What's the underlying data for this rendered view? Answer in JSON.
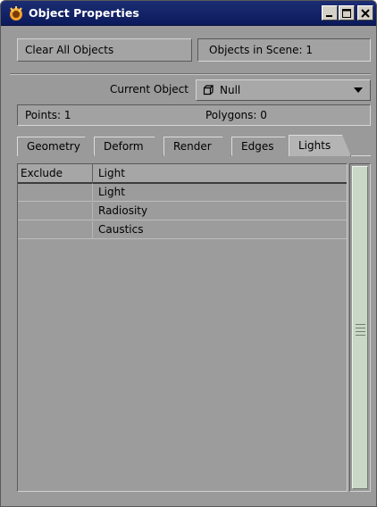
{
  "window": {
    "title": "Object Properties"
  },
  "toolbar": {
    "clear_label": "Clear All Objects",
    "objects_count": "Objects in Scene: 1"
  },
  "object_selector": {
    "label": "Current Object",
    "selected": "Null"
  },
  "counts": {
    "points": "Points: 1",
    "polygons": "Polygons: 0"
  },
  "tabs": [
    {
      "label": "Geometry",
      "active": false
    },
    {
      "label": "Deform",
      "active": false
    },
    {
      "label": "Render",
      "active": false
    },
    {
      "label": "Edges",
      "active": false
    },
    {
      "label": "Lights",
      "active": true
    }
  ],
  "list": {
    "columns": [
      "Exclude",
      "Light"
    ],
    "rows": [
      {
        "exclude": "",
        "light": "Light"
      },
      {
        "exclude": "",
        "light": "Radiosity"
      },
      {
        "exclude": "",
        "light": "Caustics"
      }
    ]
  },
  "colors": {
    "titlebar": "#0b1a5c",
    "panel": "#9a9a9a",
    "scroll_thumb": "#c9d8c7"
  }
}
